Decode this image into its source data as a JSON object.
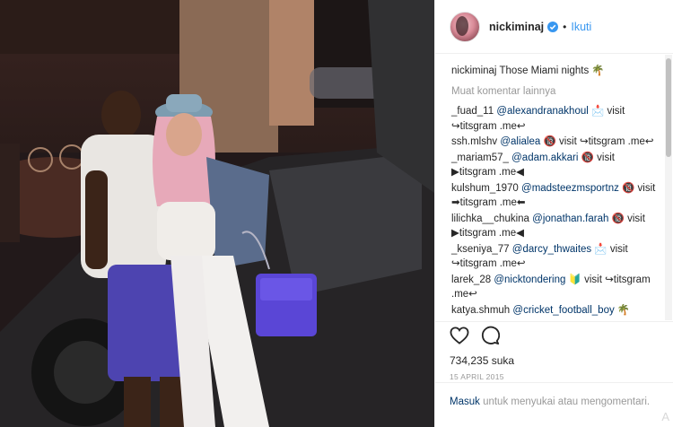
{
  "post": {
    "username": "nickiminaj",
    "follow_label": "Ikuti",
    "dot": "•"
  },
  "caption": {
    "user": "nickiminaj",
    "text": "Those Miami nights 🌴"
  },
  "load_more": "Muat komentar lainnya",
  "comments": [
    {
      "user": "_fuad_11",
      "mention": "@alexandranakhoul",
      "text": " 📩 visit ↪titsgram .me↩"
    },
    {
      "user": "ssh.mlshv",
      "mention": "@alialea",
      "text": " 🔞 visit ↪titsgram .me↩"
    },
    {
      "user": "_mariam57_",
      "mention": "@adam.akkari",
      "text": " 🔞 visit ▶titsgram .me◀"
    },
    {
      "user": "kulshum_1970",
      "mention": "@madsteezmsportnz",
      "text": " 🔞 visit ➡titsgram .me⬅"
    },
    {
      "user": "lilichka__chukina",
      "mention": "@jonathan.farah",
      "text": " 🔞 visit ▶titsgram .me◀"
    },
    {
      "user": "_kseniya_77",
      "mention": "@darcy_thwaites",
      "text": " 📩 visit ↪titsgram .me↩"
    },
    {
      "user": "larek_28",
      "mention": "@nicktondering",
      "text": " 🔰 visit ↪titsgram .me↩"
    },
    {
      "user": "katya.shmuh",
      "mention": "@cricket_football_boy",
      "text": " 🌴"
    }
  ],
  "likes": "734,235 suka",
  "date": "15 APRIL 2015",
  "login": {
    "link": "Masuk",
    "text": " untuk menyukai atau mengomentari."
  },
  "watermark": "A"
}
